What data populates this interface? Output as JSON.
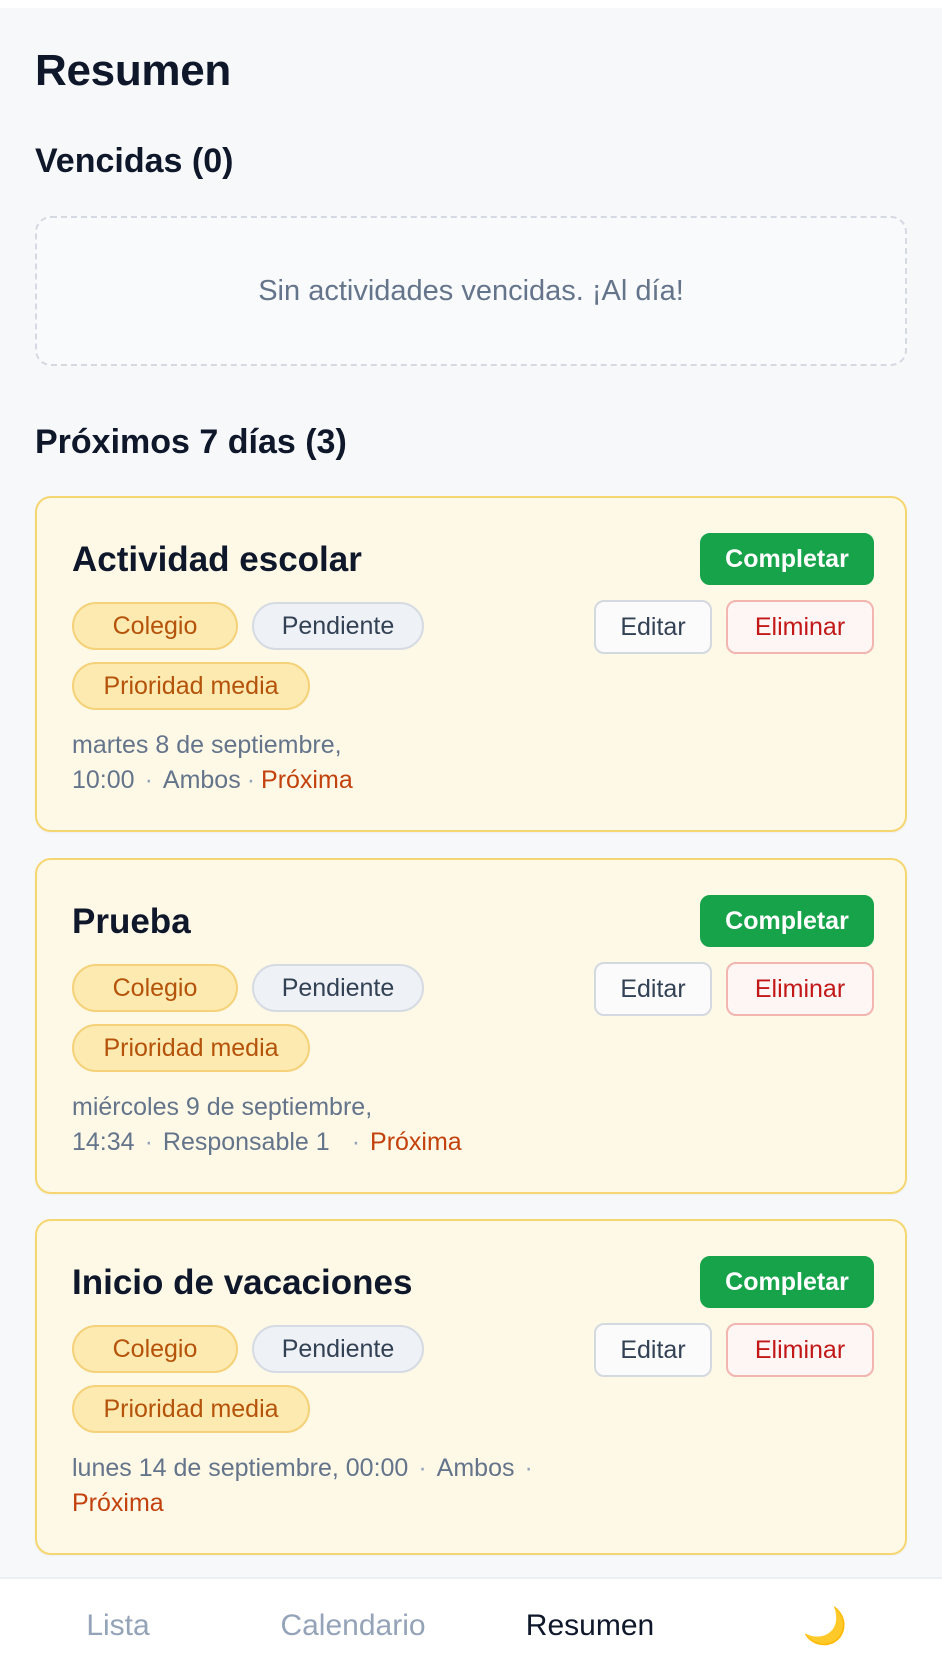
{
  "page": {
    "title": "Resumen"
  },
  "overdue": {
    "heading": "Vencidas",
    "count": "(0)",
    "empty_message": "Sin actividades vencidas. ¡Al día!"
  },
  "upcoming": {
    "heading": "Próximos 7 días",
    "count": "(3)",
    "cards": [
      {
        "title": "Actividad escolar",
        "category": "Colegio",
        "status": "Pendiente",
        "priority": "Prioridad media",
        "date": "martes 8 de septiembre,",
        "time": "10:00",
        "assignee": "Ambos",
        "tag": "Próxima",
        "complete_label": "Completar",
        "edit_label": "Editar",
        "delete_label": "Eliminar"
      },
      {
        "title": "Prueba",
        "category": "Colegio",
        "status": "Pendiente",
        "priority": "Prioridad media",
        "date": "miércoles 9 de septiembre,",
        "time": "14:34",
        "assignee": "Responsable 1",
        "tag": "Próxima",
        "complete_label": "Completar",
        "edit_label": "Editar",
        "delete_label": "Eliminar"
      },
      {
        "title": "Inicio de vacaciones",
        "category": "Colegio",
        "status": "Pendiente",
        "priority": "Prioridad media",
        "date": "lunes 14 de septiembre, 00:00",
        "assignee": "Ambos",
        "tag": "Próxima",
        "complete_label": "Completar",
        "edit_label": "Editar",
        "delete_label": "Eliminar"
      }
    ]
  },
  "nav": {
    "items": [
      {
        "label": "Lista",
        "active": false
      },
      {
        "label": "Calendario",
        "active": false
      },
      {
        "label": "Resumen",
        "active": true
      }
    ],
    "theme_icon": "moon-icon"
  },
  "colors": {
    "accent_green": "#16a34a",
    "danger_red": "#c21818",
    "card_bg": "#fef9e7",
    "next_orange": "#c2410c"
  }
}
